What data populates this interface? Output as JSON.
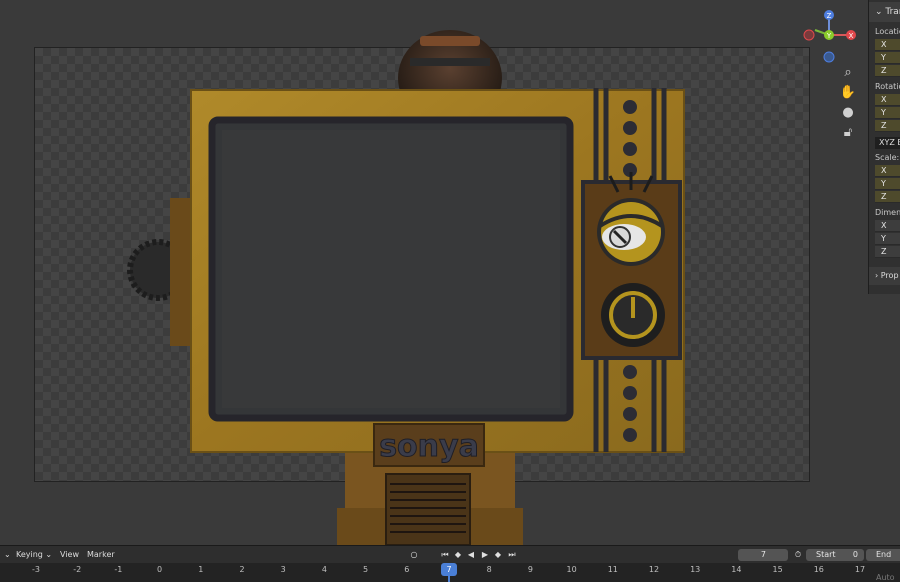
{
  "viewport": {
    "tv_label": "sonya",
    "tools": [
      "zoom-icon",
      "hand-icon",
      "camera-icon",
      "lock-icon"
    ],
    "gizmo": {
      "x": "X",
      "y": "Y",
      "z": "Z"
    }
  },
  "npanel": {
    "header": "Tran",
    "location_label": "Locatio",
    "rotation_label": "Rotatio",
    "rotation_mode": "XYZ E",
    "scale_label": "Scale:",
    "dimensions_label": "Dimens",
    "axes": [
      "X",
      "Y",
      "Z"
    ],
    "properties_label": "Prop"
  },
  "timeline": {
    "keying": "Keying",
    "view": "View",
    "marker": "Marker",
    "current_frame": "7",
    "start_label": "Start",
    "start_value": "0",
    "end_label": "End",
    "ruler": [
      "-3",
      "-2",
      "-1",
      "0",
      "1",
      "2",
      "3",
      "4",
      "5",
      "6",
      "7",
      "8",
      "9",
      "10",
      "11",
      "12",
      "13",
      "14",
      "15",
      "16",
      "17"
    ],
    "corner_text": "Auto"
  },
  "colors": {
    "tv_body": "#a07a22",
    "accent_blue": "#4a7fd6",
    "field_olive": "#4e4a2c"
  }
}
